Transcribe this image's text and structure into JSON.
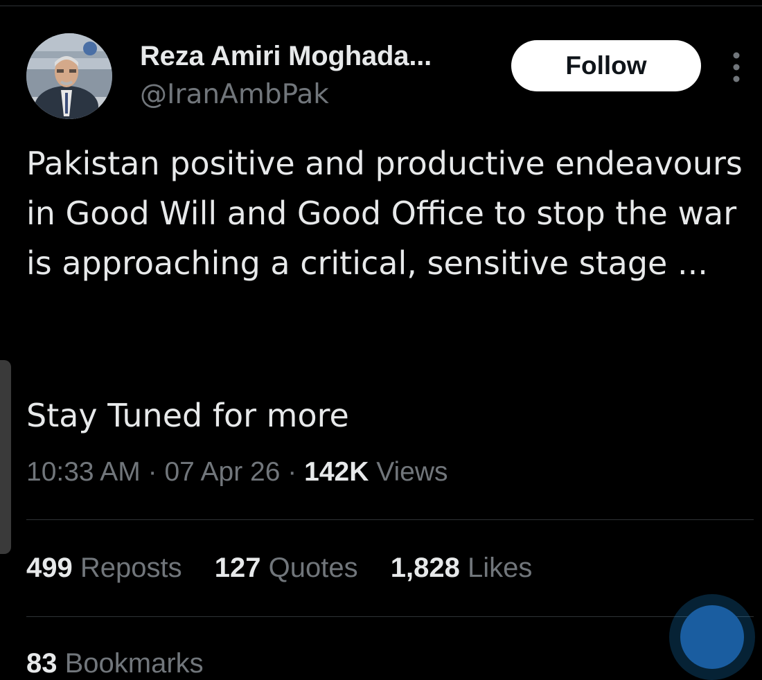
{
  "author": {
    "name": "Reza Amiri Moghada...",
    "handle": "@IranAmbPak",
    "avatar_icon": "profile-photo"
  },
  "follow_button": {
    "label": "Follow"
  },
  "more_menu": {
    "icon": "more-vertical-icon"
  },
  "tweet": {
    "text": "Pakistan positive and productive endeavours in Good Will and Good Office to stop the war is approaching a critical, sensitive stage ...",
    "text2": "Stay Tuned for more"
  },
  "meta": {
    "time": "10:33 AM",
    "separator": "·",
    "date": "07 Apr 26",
    "views_count": "142K",
    "views_label": "Views"
  },
  "stats": {
    "reposts_count": "499",
    "reposts_label": "Reposts",
    "quotes_count": "127",
    "quotes_label": "Quotes",
    "likes_count": "1,828",
    "likes_label": "Likes",
    "bookmarks_count": "83",
    "bookmarks_label": "Bookmarks"
  },
  "colors": {
    "background": "#000000",
    "primary_text": "#e7e9ea",
    "secondary_text": "#71767b",
    "divider": "#2f3336",
    "follow_bg": "#ffffff",
    "accent_blue": "#1d9bf0"
  }
}
